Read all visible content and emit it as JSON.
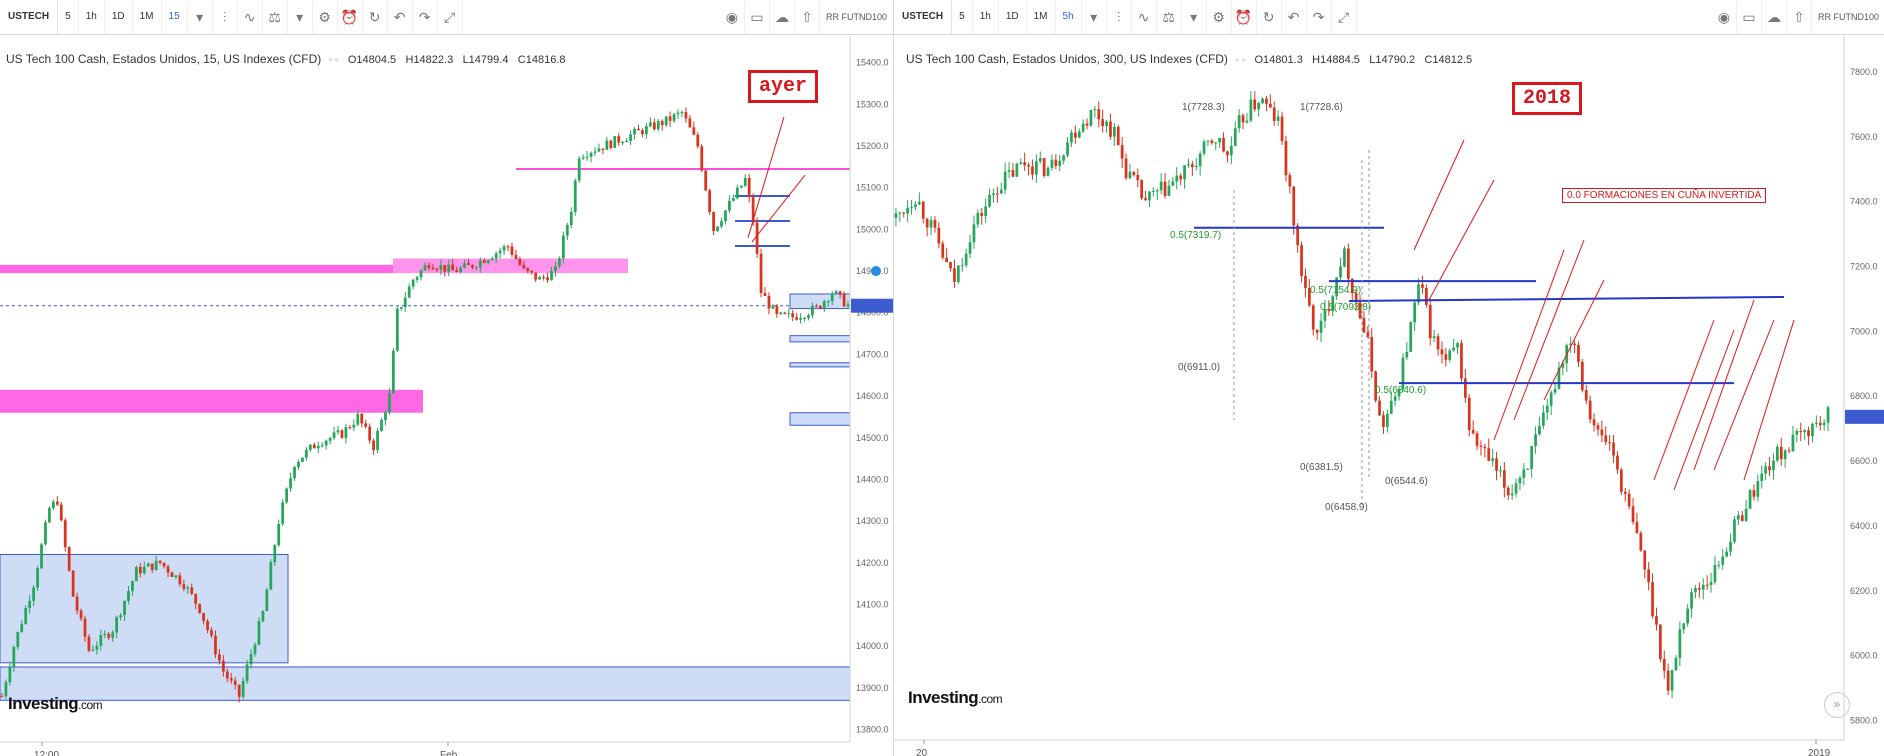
{
  "left": {
    "toolbar": {
      "symbol": "USTECH",
      "intervals": [
        "5",
        "1h",
        "1D",
        "1M",
        "15"
      ],
      "active_interval": "15",
      "account": "RR FUTND100"
    },
    "legend": {
      "title": "US Tech 100 Cash, Estados Unidos, 15, US Indexes (CFD)",
      "open": "O14804.5",
      "high": "H14822.3",
      "low": "L14799.4",
      "close": "C14816.8"
    },
    "annotation": "ayer",
    "logo": "Investing",
    "logo_suffix": ".com",
    "last_price_label": "14816.8",
    "colors": {
      "up": "#26a65b",
      "down": "#d9341e",
      "zone_pink": "#ff4de0",
      "zone_blue": "#cfdcf5",
      "zone_blue_line": "#3d5bd1",
      "dashed": "#3d5bd1"
    }
  },
  "right": {
    "toolbar": {
      "symbol": "USTECH",
      "intervals": [
        "5",
        "1h",
        "1D",
        "1M",
        "5h"
      ],
      "active_interval": "5h",
      "account": "RR FUTND100"
    },
    "legend": {
      "title": "US Tech 100 Cash, Estados Unidos, 300, US Indexes (CFD)",
      "open": "O14801.3",
      "high": "H14884.5",
      "low": "L14790.2",
      "close": "C14812.5"
    },
    "annotation": "2018",
    "note": "0.0 FORMACIONES EN CUÑA INVERTIDA",
    "logo": "Investing",
    "logo_suffix": ".com",
    "last_price_label": "6736.5",
    "fib_labels": [
      "1(7728.3)",
      "1(7728.6)",
      "0.5(7319.7)",
      "0.5(7154.9)",
      "0.5(7093.8)",
      "0.5(6840.6)",
      "0(6911.0)",
      "0(6381.5)",
      "0(6458.9)",
      "0(6544.6)"
    ]
  },
  "chart_data": [
    {
      "type": "candlestick",
      "title": "US Tech 100 Cash, Estados Unidos, 15, US Indexes (CFD)",
      "y_ticks": [
        15400,
        15300,
        15200,
        15100,
        15000,
        14900,
        14800,
        14700,
        14600,
        14500,
        14400,
        14300,
        14200,
        14100,
        14000,
        13900,
        13800
      ],
      "ylim": [
        13770,
        15440
      ],
      "x_tick_labels": [
        "12:00",
        "Feb"
      ],
      "last_price": 14816.8,
      "path": [
        [
          0,
          13880
        ],
        [
          3,
          14000
        ],
        [
          8,
          14150
        ],
        [
          12,
          14330
        ],
        [
          14,
          14350
        ],
        [
          18,
          14120
        ],
        [
          22,
          13990
        ],
        [
          28,
          14040
        ],
        [
          34,
          14180
        ],
        [
          40,
          14200
        ],
        [
          46,
          14150
        ],
        [
          50,
          14090
        ],
        [
          56,
          13940
        ],
        [
          60,
          13880
        ],
        [
          62,
          13950
        ],
        [
          66,
          14080
        ],
        [
          70,
          14300
        ],
        [
          74,
          14440
        ],
        [
          80,
          14490
        ],
        [
          86,
          14510
        ],
        [
          90,
          14550
        ],
        [
          94,
          14480
        ],
        [
          98,
          14600
        ],
        [
          100,
          14800
        ],
        [
          104,
          14880
        ],
        [
          108,
          14920
        ],
        [
          114,
          14900
        ],
        [
          118,
          14910
        ],
        [
          122,
          14930
        ],
        [
          128,
          14960
        ],
        [
          132,
          14900
        ],
        [
          136,
          14880
        ],
        [
          140,
          14900
        ],
        [
          144,
          15050
        ],
        [
          146,
          15180
        ],
        [
          152,
          15200
        ],
        [
          160,
          15230
        ],
        [
          168,
          15260
        ],
        [
          172,
          15280
        ],
        [
          176,
          15200
        ],
        [
          180,
          15000
        ],
        [
          184,
          15060
        ],
        [
          188,
          15120
        ],
        [
          190,
          15020
        ],
        [
          192,
          14850
        ],
        [
          196,
          14790
        ],
        [
          200,
          14790
        ],
        [
          206,
          14810
        ],
        [
          210,
          14850
        ],
        [
          214,
          14818
        ]
      ],
      "zones_pink": [
        [
          0,
          14920
        ],
        [
          315,
          14920
        ],
        [
          315,
          14900
        ],
        [
          340,
          14610
        ],
        [
          340,
          14560
        ]
      ],
      "levels_blue": [
        14810,
        14740,
        14680,
        14550
      ],
      "zones_blue_box": [
        [
          13960,
          14220
        ],
        [
          13870,
          13950
        ]
      ]
    },
    {
      "type": "candlestick",
      "title": "US Tech 100 Cash, Estados Unidos, 300, US Indexes (CFD)",
      "y_ticks": [
        7800,
        7600,
        7400,
        7200,
        7000,
        6800,
        6600,
        6400,
        6200,
        6000,
        5800
      ],
      "ylim": [
        5740,
        7880
      ],
      "x_tick_labels": [
        "20",
        "2019"
      ],
      "last_price": 6736.5,
      "path": [
        [
          0,
          7350
        ],
        [
          6,
          7420
        ],
        [
          12,
          7300
        ],
        [
          18,
          7150
        ],
        [
          24,
          7320
        ],
        [
          32,
          7450
        ],
        [
          40,
          7520
        ],
        [
          48,
          7500
        ],
        [
          56,
          7620
        ],
        [
          62,
          7680
        ],
        [
          68,
          7620
        ],
        [
          72,
          7500
        ],
        [
          78,
          7400
        ],
        [
          86,
          7450
        ],
        [
          92,
          7500
        ],
        [
          100,
          7600
        ],
        [
          104,
          7540
        ],
        [
          108,
          7650
        ],
        [
          114,
          7720
        ],
        [
          120,
          7640
        ],
        [
          124,
          7380
        ],
        [
          128,
          7120
        ],
        [
          132,
          6980
        ],
        [
          136,
          7100
        ],
        [
          140,
          7250
        ],
        [
          144,
          7100
        ],
        [
          148,
          6950
        ],
        [
          152,
          6700
        ],
        [
          156,
          6780
        ],
        [
          160,
          6950
        ],
        [
          164,
          7150
        ],
        [
          168,
          6980
        ],
        [
          172,
          6900
        ],
        [
          176,
          6950
        ],
        [
          180,
          6680
        ],
        [
          186,
          6600
        ],
        [
          192,
          6500
        ],
        [
          198,
          6600
        ],
        [
          204,
          6750
        ],
        [
          208,
          6900
        ],
        [
          212,
          7000
        ],
        [
          216,
          6800
        ],
        [
          220,
          6680
        ],
        [
          224,
          6650
        ],
        [
          228,
          6500
        ],
        [
          234,
          6300
        ],
        [
          238,
          6100
        ],
        [
          242,
          5880
        ],
        [
          246,
          6100
        ],
        [
          250,
          6200
        ],
        [
          256,
          6250
        ],
        [
          262,
          6380
        ],
        [
          268,
          6500
        ],
        [
          274,
          6600
        ],
        [
          280,
          6650
        ],
        [
          286,
          6700
        ],
        [
          292,
          6736
        ]
      ],
      "fib_levels": [
        7728.3,
        7319.7,
        7154.9,
        7093.8,
        6840.6,
        6911.0,
        6381.5,
        6458.9,
        6544.6
      ]
    }
  ]
}
